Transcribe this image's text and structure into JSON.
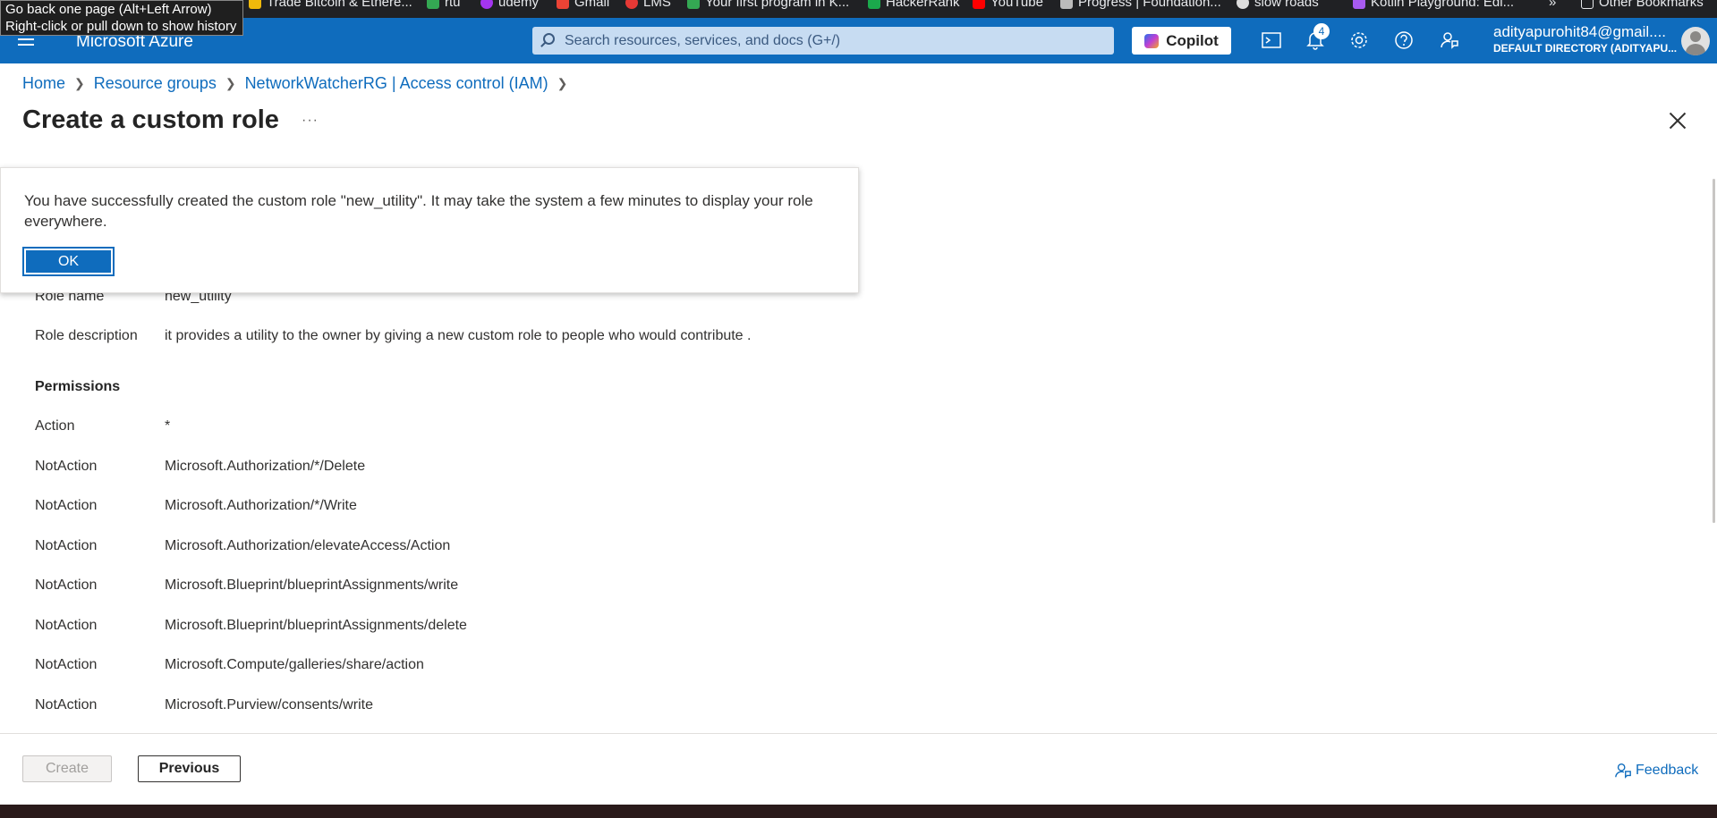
{
  "browser": {
    "tooltip_line1": "Go back one page (Alt+Left Arrow)",
    "tooltip_line2": "Right-click or pull down to show history",
    "bookmarks": [
      {
        "label": "Trade Bitcoin & Ethere...",
        "color": "#f0b90b"
      },
      {
        "label": "rtu",
        "color": "#34a853"
      },
      {
        "label": "udemy",
        "color": "#a435f0"
      },
      {
        "label": "Gmail",
        "color": "#ea4335"
      },
      {
        "label": "LMS",
        "color": "#e53935"
      },
      {
        "label": "Your first program in K...",
        "color": "#34a853"
      },
      {
        "label": "HackerRank",
        "color": "#1ba94c"
      },
      {
        "label": "YouTube",
        "color": "#ff0000"
      },
      {
        "label": "Progress | Foundation...",
        "color": "#bbbbbb"
      },
      {
        "label": "slow roads",
        "color": "#dddddd"
      },
      {
        "label": "Kotlin Playground: Edi...",
        "color": "#a75bf0"
      }
    ],
    "overflow": "»",
    "other_bookmarks": "Other Bookmarks"
  },
  "header": {
    "brand": "Microsoft Azure",
    "search_placeholder": "Search resources, services, and docs (G+/)",
    "copilot": "Copilot",
    "notifications_count": "4",
    "user_email": "adityapurohit84@gmail....",
    "user_directory": "DEFAULT DIRECTORY (ADITYAPU..."
  },
  "breadcrumb": {
    "home": "Home",
    "resource_groups": "Resource groups",
    "iam": "NetworkWatcherRG | Access control (IAM)"
  },
  "page": {
    "title": "Create a custom role",
    "more": "···"
  },
  "dialog": {
    "message": "You have successfully created the custom role \"new_utility\". It may take the system a few minutes to display your role everywhere.",
    "ok": "OK"
  },
  "details": {
    "role_name_label": "Role name",
    "role_name": "new_utility",
    "role_description_label": "Role description",
    "role_description": "it provides a utility to the owner by giving a new custom role to people who would contribute .",
    "permissions_heading": "Permissions",
    "permissions": [
      {
        "type": "Action",
        "value": "*"
      },
      {
        "type": "NotAction",
        "value": "Microsoft.Authorization/*/Delete"
      },
      {
        "type": "NotAction",
        "value": "Microsoft.Authorization/*/Write"
      },
      {
        "type": "NotAction",
        "value": "Microsoft.Authorization/elevateAccess/Action"
      },
      {
        "type": "NotAction",
        "value": "Microsoft.Blueprint/blueprintAssignments/write"
      },
      {
        "type": "NotAction",
        "value": "Microsoft.Blueprint/blueprintAssignments/delete"
      },
      {
        "type": "NotAction",
        "value": "Microsoft.Compute/galleries/share/action"
      },
      {
        "type": "NotAction",
        "value": "Microsoft.Purview/consents/write"
      }
    ]
  },
  "footer": {
    "create": "Create",
    "previous": "Previous",
    "feedback": "Feedback"
  }
}
